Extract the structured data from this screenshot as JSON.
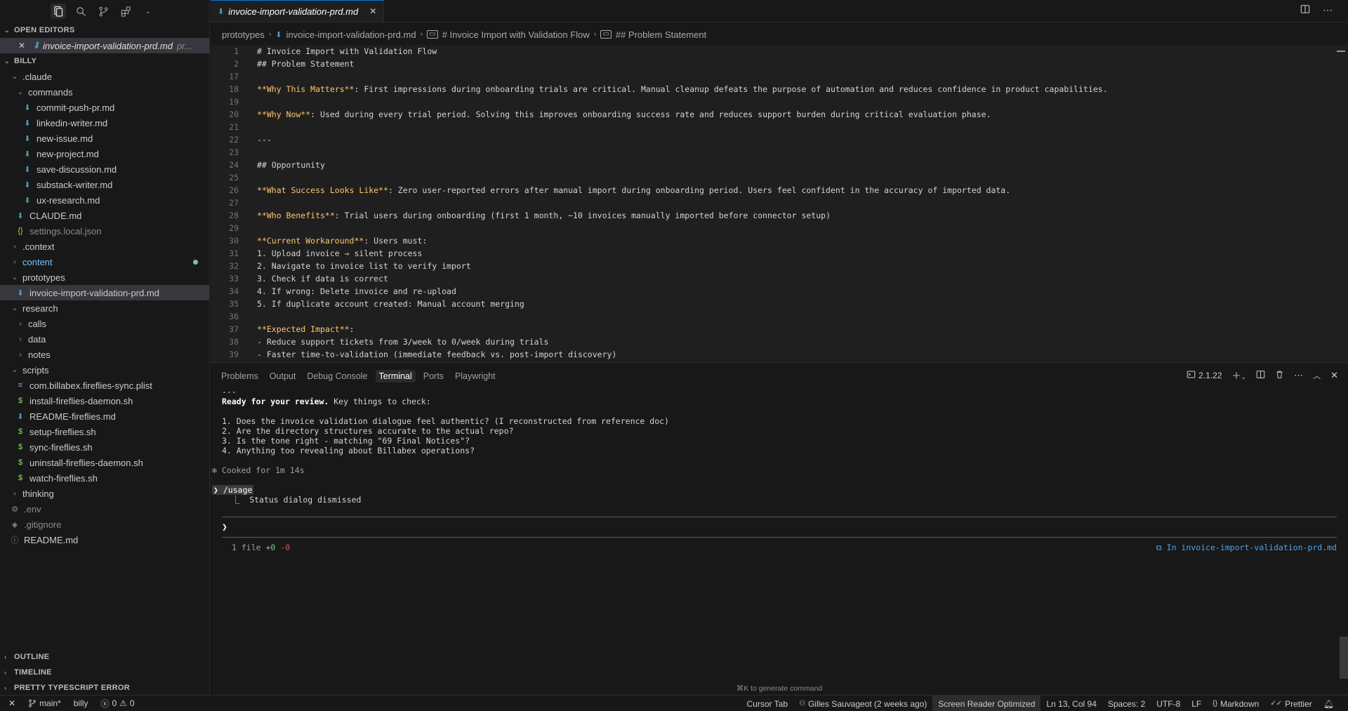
{
  "sidebar": {
    "open_editors_title": "OPEN EDITORS",
    "open_editor": {
      "name": "invoice-import-validation-prd.md",
      "suffix": "pr..."
    },
    "workspace_title": "BILLY",
    "outline_title": "OUTLINE",
    "timeline_title": "TIMELINE",
    "pretty_ts_title": "PRETTY TYPESCRIPT ERROR",
    "tree": {
      "claude": ".claude",
      "commands": "commands",
      "commit_push_pr": "commit-push-pr.md",
      "linkedin_writer": "linkedin-writer.md",
      "new_issue": "new-issue.md",
      "new_project": "new-project.md",
      "save_discussion": "save-discussion.md",
      "substack_writer": "substack-writer.md",
      "ux_research": "ux-research.md",
      "claude_md": "CLAUDE.md",
      "settings_local": "settings.local.json",
      "context": ".context",
      "content": "content",
      "prototypes": "prototypes",
      "invoice_prd": "invoice-import-validation-prd.md",
      "research": "research",
      "calls": "calls",
      "data": "data",
      "notes": "notes",
      "scripts": "scripts",
      "plist": "com.billabex.fireflies-sync.plist",
      "install_daemon": "install-fireflies-daemon.sh",
      "readme_fireflies": "README-fireflies.md",
      "setup_fireflies": "setup-fireflies.sh",
      "sync_fireflies": "sync-fireflies.sh",
      "uninstall_daemon": "uninstall-fireflies-daemon.sh",
      "watch_fireflies": "watch-fireflies.sh",
      "thinking": "thinking",
      "env": ".env",
      "gitignore": ".gitignore",
      "readme": "README.md"
    }
  },
  "editor": {
    "tab_label": "invoice-import-validation-prd.md",
    "breadcrumb": {
      "folder": "prototypes",
      "file": "invoice-import-validation-prd.md",
      "h1": "# Invoice Import with Validation Flow",
      "h2": "## Problem Statement"
    },
    "lines": [
      {
        "n": "1",
        "text": "# Invoice Import with Validation Flow"
      },
      {
        "n": "2",
        "text": "## Problem Statement"
      },
      {
        "n": "17",
        "text": ""
      },
      {
        "n": "18",
        "bold": "**Why This Matters**",
        "text": ": First impressions during onboarding trials are critical. Manual cleanup defeats the purpose of automation and reduces confidence in product capabilities."
      },
      {
        "n": "19",
        "text": ""
      },
      {
        "n": "20",
        "bold": "**Why Now**",
        "text": ": Used during every trial period. Solving this improves onboarding success rate and reduces support burden during critical evaluation phase."
      },
      {
        "n": "21",
        "text": ""
      },
      {
        "n": "22",
        "text": "---"
      },
      {
        "n": "23",
        "text": ""
      },
      {
        "n": "24",
        "text": "## Opportunity"
      },
      {
        "n": "25",
        "text": ""
      },
      {
        "n": "26",
        "bold": "**What Success Looks Like**",
        "text": ": Zero user-reported errors after manual import during onboarding period. Users feel confident in the accuracy of imported data."
      },
      {
        "n": "27",
        "text": ""
      },
      {
        "n": "28",
        "bold": "**Who Benefits**",
        "text": ": Trial users during onboarding (first 1 month, ~10 invoices manually imported before connector setup)"
      },
      {
        "n": "29",
        "text": ""
      },
      {
        "n": "30",
        "bold": "**Current Workaround**",
        "text": ": Users must:"
      },
      {
        "n": "31",
        "text": "1. Upload invoice → silent process"
      },
      {
        "n": "32",
        "text": "2. Navigate to invoice list to verify import"
      },
      {
        "n": "33",
        "text": "3. Check if data is correct"
      },
      {
        "n": "34",
        "text": "4. If wrong: Delete invoice and re-upload"
      },
      {
        "n": "35",
        "text": "5. If duplicate account created: Manual account merging"
      },
      {
        "n": "36",
        "text": ""
      },
      {
        "n": "37",
        "bold": "**Expected Impact**",
        "text": ":"
      },
      {
        "n": "38",
        "text": "- Reduce support tickets from 3/week to 0/week during trials"
      },
      {
        "n": "39",
        "text": "- Faster time-to-validation (immediate feedback vs. post-import discovery)"
      }
    ]
  },
  "panel": {
    "tabs": [
      "Problems",
      "Output",
      "Debug Console",
      "Terminal",
      "Ports",
      "Playwright"
    ],
    "active_tab": "Terminal",
    "version": "2.1.22",
    "terminal": {
      "rule": "---",
      "review_bold": "Ready for your review.",
      "review_rest": " Key things to check:",
      "checks": [
        "1. Does the invoice validation dialogue feel authentic? (I reconstructed from reference doc)",
        "2. Are the directory structures accurate to the actual repo?",
        "3. Is the tone right - matching \"69 Final Notices\"?",
        "4. Anything too revealing about Billabex operations?"
      ],
      "cooked": "✻ Cooked for 1m 14s",
      "command_prefix": "❯",
      "command": "/usage",
      "status_line": "  ⎿  Status dialog dismissed",
      "input_prompt": "❯",
      "footer_files": "1 file",
      "footer_plus": "+0",
      "footer_minus": "-0",
      "footer_right": "⧉ In invoice-import-validation-prd.md"
    },
    "hint": "⌘K to generate command"
  },
  "statusbar": {
    "branch": "main*",
    "workspace": "billy",
    "errors": "0",
    "warnings": "0",
    "cursor_tab": "Cursor Tab",
    "blame": "Gilles Sauvageot (2 weeks ago)",
    "screen_reader": "Screen Reader Optimized",
    "position": "Ln 13, Col 94",
    "spaces": "Spaces: 2",
    "encoding": "UTF-8",
    "eol": "LF",
    "language": "Markdown",
    "formatter": "Prettier"
  }
}
